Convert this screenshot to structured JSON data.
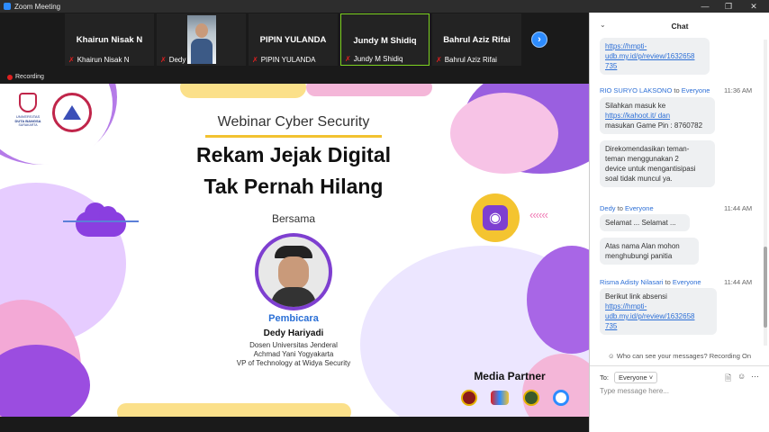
{
  "window": {
    "title": "Zoom Meeting"
  },
  "participants": [
    {
      "big_name": "Khairun Nisak N",
      "label": "Khairun Nisak N"
    },
    {
      "big_name": "",
      "label": "Dedy"
    },
    {
      "big_name": "PIPIN YULANDA",
      "label": "PIPIN YULANDA"
    },
    {
      "big_name": "Jundy M Shidiq",
      "label": "Jundy M Shidiq"
    },
    {
      "big_name": "Bahrul Aziz Rifai",
      "label": "Bahrul Aziz Rifai"
    }
  ],
  "recording_label": "Recording",
  "slide": {
    "logo_text_1": "UNIVERSITAS",
    "logo_text_2": "DUTA BANGSA",
    "logo_text_3": "SURAKARTA",
    "subtitle": "Webinar Cyber Security",
    "title_line1": "Rekam Jejak Digital",
    "title_line2": "Tak Pernah Hilang",
    "with": "Bersama",
    "role": "Pembicara",
    "speaker": "Dedy Hariyadi",
    "desc_line1": "Dosen Universitas Jenderal",
    "desc_line2": "Achmad Yani Yogyakarta",
    "desc_line3": "VP of Technology at Widya Security",
    "media_partner": "Media Partner"
  },
  "chat": {
    "title": "Chat",
    "messages": [
      {
        "sender": "",
        "to": "",
        "time": "",
        "lines": [
          "https://hmpti-",
          "udb.my.id/p/review/1632658",
          "735"
        ]
      },
      {
        "sender": "RIO SURYO LAKSONO",
        "to": "Everyone",
        "time": "11:36 AM",
        "bubble1": [
          "Silahkan masuk ke",
          "https://kahoot.it/ dan",
          "masukan Game Pin : 8760782"
        ],
        "bubble2": [
          "Direkomendasikan teman-",
          "teman menggunakan 2",
          "device untuk mengantisipasi",
          "soal tidak muncul ya."
        ]
      },
      {
        "sender": "Dedy",
        "to": "Everyone",
        "time": "11:44 AM",
        "bubble1": [
          "Selamat ... Selamat ..."
        ],
        "bubble2": [
          "Atas nama Alan mohon",
          "menghubungi panitia"
        ]
      },
      {
        "sender": "Risma Adisty Nilasari",
        "to": "Everyone",
        "time": "11:44 AM",
        "bubble1": [
          "Berikut link absensi",
          "https://hmpti-",
          "udb.my.id/p/review/1632658",
          "735"
        ]
      }
    ],
    "to_word": "to",
    "privacy_notice": "Who can see your messages? Recording On",
    "to_label": "To:",
    "recipient": "Everyone",
    "input_placeholder": "Type message here..."
  },
  "colors": {
    "accent": "#2d8cff",
    "link": "#2d6fd6",
    "active_tile": "#7ed321",
    "mic_muted": "#e02020"
  }
}
